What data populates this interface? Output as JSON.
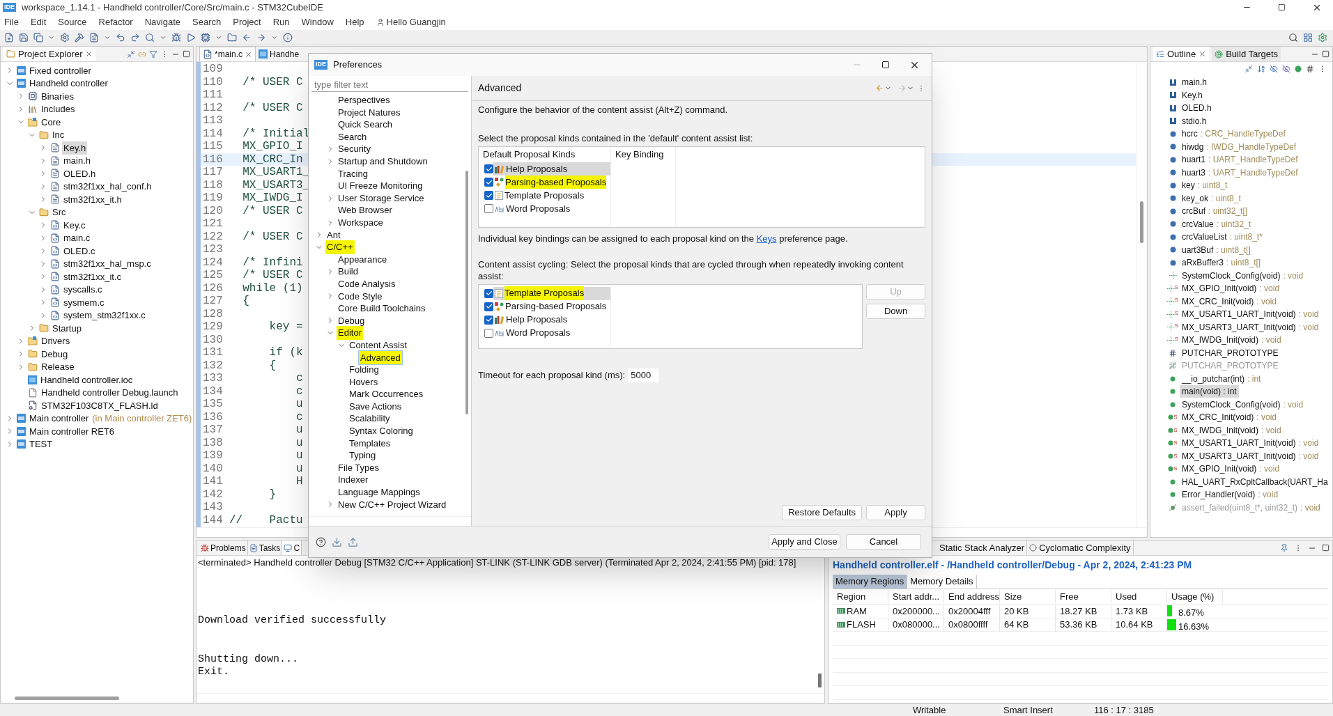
{
  "window": {
    "app_icon": "IDE",
    "title": "workspace_1.14.1 - Handheld controller/Core/Src/main.c - STM32CubeIDE"
  },
  "menu": [
    "File",
    "Edit",
    "Source",
    "Refactor",
    "Navigate",
    "Search",
    "Project",
    "Run",
    "Window",
    "Help"
  ],
  "user": "Hello Guangjin",
  "project_explorer": {
    "title": "Project Explorer",
    "tree": [
      {
        "label": "Fixed controller",
        "kind": "project",
        "expanded": false,
        "selected": false
      },
      {
        "label": "Handheld controller",
        "kind": "project",
        "expanded": true,
        "selected": false,
        "children": [
          {
            "label": "Binaries",
            "kind": "binaries",
            "expanded": false,
            "selected": false
          },
          {
            "label": "Includes",
            "kind": "includes",
            "expanded": false,
            "selected": false
          },
          {
            "label": "Core",
            "kind": "source-folder",
            "expanded": true,
            "selected": false,
            "children": [
              {
                "label": "Inc",
                "kind": "folder",
                "expanded": true,
                "selected": false,
                "children": [
                  {
                    "label": "Key.h",
                    "kind": "h-file",
                    "expanded": false,
                    "selected": true
                  },
                  {
                    "label": "main.h",
                    "kind": "h-file",
                    "expanded": false,
                    "selected": false
                  },
                  {
                    "label": "OLED.h",
                    "kind": "h-file",
                    "expanded": false,
                    "selected": false
                  },
                  {
                    "label": "stm32f1xx_hal_conf.h",
                    "kind": "h-file",
                    "expanded": false,
                    "selected": false
                  },
                  {
                    "label": "stm32f1xx_it.h",
                    "kind": "h-file",
                    "expanded": false,
                    "selected": false
                  }
                ]
              },
              {
                "label": "Src",
                "kind": "folder",
                "expanded": true,
                "selected": false,
                "children": [
                  {
                    "label": "Key.c",
                    "kind": "c-file",
                    "expanded": false,
                    "selected": false
                  },
                  {
                    "label": "main.c",
                    "kind": "c-file",
                    "expanded": false,
                    "selected": false
                  },
                  {
                    "label": "OLED.c",
                    "kind": "c-file",
                    "expanded": false,
                    "selected": false
                  },
                  {
                    "label": "stm32f1xx_hal_msp.c",
                    "kind": "c-file",
                    "expanded": false,
                    "selected": false
                  },
                  {
                    "label": "stm32f1xx_it.c",
                    "kind": "c-file",
                    "expanded": false,
                    "selected": false
                  },
                  {
                    "label": "syscalls.c",
                    "kind": "c-file",
                    "expanded": false,
                    "selected": false
                  },
                  {
                    "label": "sysmem.c",
                    "kind": "c-file",
                    "expanded": false,
                    "selected": false
                  },
                  {
                    "label": "system_stm32f1xx.c",
                    "kind": "c-file",
                    "expanded": false,
                    "selected": false
                  }
                ]
              },
              {
                "label": "Startup",
                "kind": "folder",
                "expanded": false,
                "selected": false
              }
            ]
          },
          {
            "label": "Drivers",
            "kind": "source-folder",
            "expanded": false,
            "selected": false
          },
          {
            "label": "Debug",
            "kind": "folder",
            "expanded": false,
            "selected": false
          },
          {
            "label": "Release",
            "kind": "folder",
            "expanded": false,
            "selected": false
          },
          {
            "label": "Handheld controller.ioc",
            "kind": "mx-file",
            "selected": false
          },
          {
            "label": "Handheld controller Debug.launch",
            "kind": "launch-file",
            "selected": false
          },
          {
            "label": "STM32F103C8TX_FLASH.ld",
            "kind": "ld-file",
            "selected": false
          }
        ]
      },
      {
        "label": "Main controller",
        "annotation": "(in Main controller ZET6)",
        "kind": "project",
        "expanded": false,
        "selected": false
      },
      {
        "label": "Main controller RET6",
        "kind": "project",
        "expanded": false,
        "selected": false
      },
      {
        "label": "TEST",
        "kind": "project",
        "expanded": false,
        "selected": false
      }
    ]
  },
  "editor": {
    "tabs": [
      {
        "label": "*main.c",
        "kind": "c-file",
        "selected": true
      },
      {
        "label": "Handhe",
        "kind": "mx-file",
        "selected": false
      }
    ],
    "lines": [
      {
        "number": "109",
        "current": false
      },
      {
        "number": "110",
        "code": "  /* USER C",
        "current": false
      },
      {
        "number": "111",
        "current": false
      },
      {
        "number": "112",
        "code": "  /* USER C",
        "current": false
      },
      {
        "number": "113",
        "current": false
      },
      {
        "number": "114",
        "code": "  /* Initial",
        "current": false
      },
      {
        "number": "115",
        "code": "  MX_GPIO_I",
        "current": false
      },
      {
        "number": "116",
        "code": "  MX_CRC_In",
        "current": true
      },
      {
        "number": "117",
        "code": "  MX_USART1_",
        "current": false
      },
      {
        "number": "118",
        "code": "  MX_USART3_",
        "current": false
      },
      {
        "number": "119",
        "code": "  MX_IWDG_I",
        "current": false
      },
      {
        "number": "120",
        "code": "  /* USER C",
        "current": false
      },
      {
        "number": "121",
        "current": false
      },
      {
        "number": "122",
        "code": "  /* USER C",
        "current": false
      },
      {
        "number": "123",
        "current": false
      },
      {
        "number": "124",
        "code": "  /* Infini",
        "current": false
      },
      {
        "number": "125",
        "code": "  /* USER C",
        "current": false
      },
      {
        "number": "126",
        "code": "  while (1)",
        "current": false
      },
      {
        "number": "127",
        "code": "  {",
        "current": false
      },
      {
        "number": "128",
        "current": false
      },
      {
        "number": "129",
        "code": "      key =",
        "current": false
      },
      {
        "number": "130",
        "current": false
      },
      {
        "number": "131",
        "code": "      if (k",
        "current": false
      },
      {
        "number": "132",
        "code": "      {",
        "current": false
      },
      {
        "number": "133",
        "code": "          c",
        "current": false
      },
      {
        "number": "134",
        "code": "          c",
        "current": false
      },
      {
        "number": "135",
        "code": "          u",
        "current": false
      },
      {
        "number": "136",
        "code": "          c",
        "current": false
      },
      {
        "number": "137",
        "code": "          u",
        "current": false
      },
      {
        "number": "138",
        "code": "          u",
        "current": false
      },
      {
        "number": "139",
        "code": "          u",
        "current": false
      },
      {
        "number": "140",
        "code": "          u",
        "current": false
      },
      {
        "number": "141",
        "code": "          H",
        "current": false
      },
      {
        "number": "142",
        "code": "      }",
        "current": false
      },
      {
        "number": "143",
        "current": false
      },
      {
        "number": "144",
        "code": "//    Pactu",
        "current": false
      }
    ]
  },
  "outline": {
    "tabs": [
      {
        "label": "Outline",
        "selected": true
      },
      {
        "label": "Build Targets",
        "selected": false
      }
    ],
    "items": [
      {
        "kind": "include",
        "name": "main.h",
        "selected": false
      },
      {
        "kind": "include",
        "name": "Key.h",
        "selected": false
      },
      {
        "kind": "include",
        "name": "OLED.h",
        "selected": false
      },
      {
        "kind": "include",
        "name": "stdio.h",
        "selected": false
      },
      {
        "kind": "variable",
        "name": "hcrc",
        "type": ": CRC_HandleTypeDef",
        "selected": false
      },
      {
        "kind": "variable",
        "name": "hiwdg",
        "type": ": IWDG_HandleTypeDef",
        "selected": false
      },
      {
        "kind": "variable",
        "name": "huart1",
        "type": ": UART_HandleTypeDef",
        "selected": false
      },
      {
        "kind": "variable",
        "name": "huart3",
        "type": ": UART_HandleTypeDef",
        "selected": false
      },
      {
        "kind": "variable",
        "name": "key",
        "type": ": uint8_t",
        "selected": false
      },
      {
        "kind": "variable",
        "name": "key_ok",
        "type": ": uint8_t",
        "selected": false
      },
      {
        "kind": "variable",
        "name": "crcBuf",
        "type": ": uint32_t[]",
        "selected": false
      },
      {
        "kind": "variable",
        "name": "crcValue",
        "type": ": uint32_t",
        "selected": false
      },
      {
        "kind": "variable",
        "name": "crcValueList",
        "type": ": uint8_t*",
        "selected": false
      },
      {
        "kind": "variable",
        "name": "uart3Buf",
        "type": ": uint8_t[]",
        "selected": false
      },
      {
        "kind": "variable",
        "name": "aRxBuffer3",
        "type": ": uint8_t[]",
        "selected": false
      },
      {
        "kind": "declaration",
        "name": "SystemClock_Config(void)",
        "type": ": void",
        "selected": false
      },
      {
        "kind": "declaration",
        "badge": "S",
        "name": "MX_GPIO_Init(void)",
        "type": ": void",
        "selected": false
      },
      {
        "kind": "declaration",
        "badge": "S",
        "name": "MX_CRC_Init(void)",
        "type": ": void",
        "selected": false
      },
      {
        "kind": "declaration",
        "badge": "S",
        "name": "MX_USART1_UART_Init(void)",
        "type": ": void",
        "selected": false
      },
      {
        "kind": "declaration",
        "badge": "S",
        "name": "MX_USART3_UART_Init(void)",
        "type": ": void",
        "selected": false
      },
      {
        "kind": "declaration",
        "badge": "S",
        "name": "MX_IWDG_Init(void)",
        "type": ": void",
        "selected": false
      },
      {
        "kind": "macro",
        "name": "PUTCHAR_PROTOTYPE",
        "selected": false
      },
      {
        "kind": "macro-inactive",
        "name": "PUTCHAR_PROTOTYPE",
        "selected": false
      },
      {
        "kind": "function",
        "name": "__io_putchar(int)",
        "type": ": int",
        "selected": false
      },
      {
        "kind": "function",
        "name": "main(void) : int",
        "selected": true
      },
      {
        "kind": "function",
        "name": "SystemClock_Config(void)",
        "type": ": void",
        "selected": false
      },
      {
        "kind": "function",
        "badge": "S",
        "name": "MX_CRC_Init(void)",
        "type": ": void",
        "selected": false
      },
      {
        "kind": "function",
        "badge": "S",
        "name": "MX_IWDG_Init(void)",
        "type": ": void",
        "selected": false
      },
      {
        "kind": "function",
        "badge": "S",
        "name": "MX_USART1_UART_Init(void)",
        "type": ": void",
        "selected": false
      },
      {
        "kind": "function",
        "badge": "S",
        "name": "MX_USART3_UART_Init(void)",
        "type": ": void",
        "selected": false
      },
      {
        "kind": "function",
        "badge": "S",
        "name": "MX_GPIO_Init(void)",
        "type": ": void",
        "selected": false
      },
      {
        "kind": "function",
        "name": "HAL_UART_RxCpltCallback(UART_Ha",
        "selected": false
      },
      {
        "kind": "function",
        "name": "Error_Handler(void)",
        "type": ": void",
        "selected": false
      },
      {
        "kind": "function-inactive",
        "name": "assert_failed(uint8_t*, uint32_t)",
        "type": ": void",
        "selected": false
      }
    ]
  },
  "preferences": {
    "app_icon": "IDE",
    "title": "Preferences",
    "filter_placeholder": "type filter text",
    "continued_children": [
      {
        "label": "Perspectives",
        "selected": false,
        "highlighted": false
      },
      {
        "label": "Project Natures",
        "selected": false,
        "highlighted": false
      },
      {
        "label": "Quick Search",
        "selected": false,
        "highlighted": false
      },
      {
        "label": "Search",
        "selected": false,
        "highlighted": false
      },
      {
        "label": "Security",
        "expanded": false,
        "selected": false,
        "highlighted": false
      },
      {
        "label": "Startup and Shutdown",
        "expanded": false,
        "selected": false,
        "highlighted": false
      },
      {
        "label": "Tracing",
        "selected": false,
        "highlighted": false
      },
      {
        "label": "UI Freeze Monitoring",
        "selected": false,
        "highlighted": false
      },
      {
        "label": "User Storage Service",
        "expanded": false,
        "selected": false,
        "highlighted": false
      },
      {
        "label": "Web Browser",
        "selected": false,
        "highlighted": false
      },
      {
        "label": "Workspace",
        "expanded": false,
        "selected": false,
        "highlighted": false
      }
    ],
    "tree": [
      {
        "label": "Ant",
        "expanded": false,
        "selected": false,
        "highlighted": false
      },
      {
        "label": "C/C++",
        "expanded": true,
        "selected": false,
        "highlighted": true,
        "children": [
          {
            "label": "Appearance",
            "selected": false,
            "highlighted": false
          },
          {
            "label": "Build",
            "expanded": false,
            "selected": false,
            "highlighted": false
          },
          {
            "label": "Code Analysis",
            "selected": false,
            "highlighted": false
          },
          {
            "label": "Code Style",
            "expanded": false,
            "selected": false,
            "highlighted": false
          },
          {
            "label": "Core Build Toolchains",
            "selected": false,
            "highlighted": false
          },
          {
            "label": "Debug",
            "expanded": false,
            "selected": false,
            "highlighted": false
          },
          {
            "label": "Editor",
            "expanded": true,
            "selected": false,
            "highlighted": true,
            "children": [
              {
                "label": "Content Assist",
                "expanded": true,
                "selected": false,
                "highlighted": false,
                "children": [
                  {
                    "label": "Advanced",
                    "selected": true,
                    "highlighted": true
                  }
                ]
              },
              {
                "label": "Folding",
                "selected": false,
                "highlighted": false
              },
              {
                "label": "Hovers",
                "selected": false,
                "highlighted": false
              },
              {
                "label": "Mark Occurrences",
                "selected": false,
                "highlighted": false
              },
              {
                "label": "Save Actions",
                "selected": false,
                "highlighted": false
              },
              {
                "label": "Scalability",
                "selected": false,
                "highlighted": false
              },
              {
                "label": "Syntax Coloring",
                "selected": false,
                "highlighted": false
              },
              {
                "label": "Templates",
                "selected": false,
                "highlighted": false
              },
              {
                "label": "Typing",
                "selected": false,
                "highlighted": false
              }
            ]
          },
          {
            "label": "File Types",
            "selected": false,
            "highlighted": false
          },
          {
            "label": "Indexer",
            "selected": false,
            "highlighted": false
          },
          {
            "label": "Language Mappings",
            "selected": false,
            "highlighted": false
          },
          {
            "label": "New C/C++ Project Wizard",
            "expanded": false,
            "selected": false,
            "highlighted": false
          }
        ]
      }
    ],
    "page_title": "Advanced",
    "description": "Configure the behavior of the content assist (Alt+Z) command.",
    "default_list_label": "Select the proposal kinds contained in the 'default' content assist list:",
    "default_columns": [
      "Default Proposal Kinds",
      "Key Binding"
    ],
    "default_rows": [
      {
        "kind": "help",
        "label": "Help Proposals",
        "checked": true,
        "selected": true,
        "highlighted": false
      },
      {
        "kind": "parsing",
        "label": "Parsing-based Proposals",
        "checked": true,
        "selected": false,
        "highlighted": true
      },
      {
        "kind": "template",
        "label": "Template Proposals",
        "checked": true,
        "selected": false,
        "highlighted": false
      },
      {
        "kind": "word",
        "label": "Word Proposals",
        "checked": false,
        "selected": false,
        "highlighted": false
      }
    ],
    "keys_note": {
      "before": "Individual key bindings can be assigned to each proposal kind on the",
      "link": "Keys",
      "after": "preference page."
    },
    "cycling_label": "Content assist cycling: Select the proposal kinds that are cycled through when repeatedly invoking content assist:",
    "cycling_rows": [
      {
        "kind": "template",
        "label": "Template Proposals",
        "checked": true,
        "selected": true,
        "highlighted": true
      },
      {
        "kind": "parsing",
        "label": "Parsing-based Proposals",
        "checked": true,
        "selected": false,
        "highlighted": false
      },
      {
        "kind": "help",
        "label": "Help Proposals",
        "checked": true,
        "selected": false,
        "highlighted": false
      },
      {
        "kind": "word",
        "label": "Word Proposals",
        "checked": false,
        "selected": false,
        "highlighted": false
      }
    ],
    "up_button": {
      "label": "Up",
      "disabled": true
    },
    "down_button": {
      "label": "Down",
      "disabled": false
    },
    "timeout_label": "Timeout for each proposal kind (ms):",
    "timeout_value": "5000",
    "restore_defaults": "Restore Defaults",
    "apply": "Apply",
    "apply_and_close": "Apply and Close",
    "cancel": "Cancel"
  },
  "console": {
    "tabs": [
      {
        "label": "Problems",
        "selected": false
      },
      {
        "label": "Tasks",
        "selected": false
      },
      {
        "label": "C",
        "selected": true
      }
    ],
    "header": "<terminated> Handheld controller Debug [STM32 C/C++ Application] ST-LINK (ST-LINK GDB server) (Terminated Apr 2, 2024, 2:41:55 PM) [pid: 178]",
    "lines": [
      "Download verified successfully",
      "Shutting down...",
      "Exit."
    ]
  },
  "memory": {
    "tabs": [
      {
        "label": "Static Stack Analyzer",
        "selected": false
      },
      {
        "label": "Cyclomatic Complexity",
        "selected": false
      }
    ],
    "title": "Handheld controller.elf - /Handheld controller/Debug - Apr 2, 2024, 2:41:23 PM",
    "subtabs": [
      {
        "label": "Memory Regions",
        "selected": true
      },
      {
        "label": "Memory Details",
        "selected": false
      }
    ],
    "columns": [
      "Region",
      "Start addr...",
      "End address",
      "Size",
      "Free",
      "Used",
      "Usage (%)"
    ],
    "rows": [
      {
        "cells": [
          "RAM",
          "0x200000...",
          "0x20004fff",
          "20 KB",
          "18.27 KB",
          "1.73 KB",
          "8.67%"
        ],
        "level": 0.0867
      },
      {
        "cells": [
          "FLASH",
          "0x080000...",
          "0x0800ffff",
          "64 KB",
          "53.36 KB",
          "10.64 KB",
          "16.63%"
        ],
        "level": 0.1663
      }
    ]
  },
  "status_bar": [
    "Writable",
    "Smart Insert",
    "116 : 17 : 3185"
  ]
}
